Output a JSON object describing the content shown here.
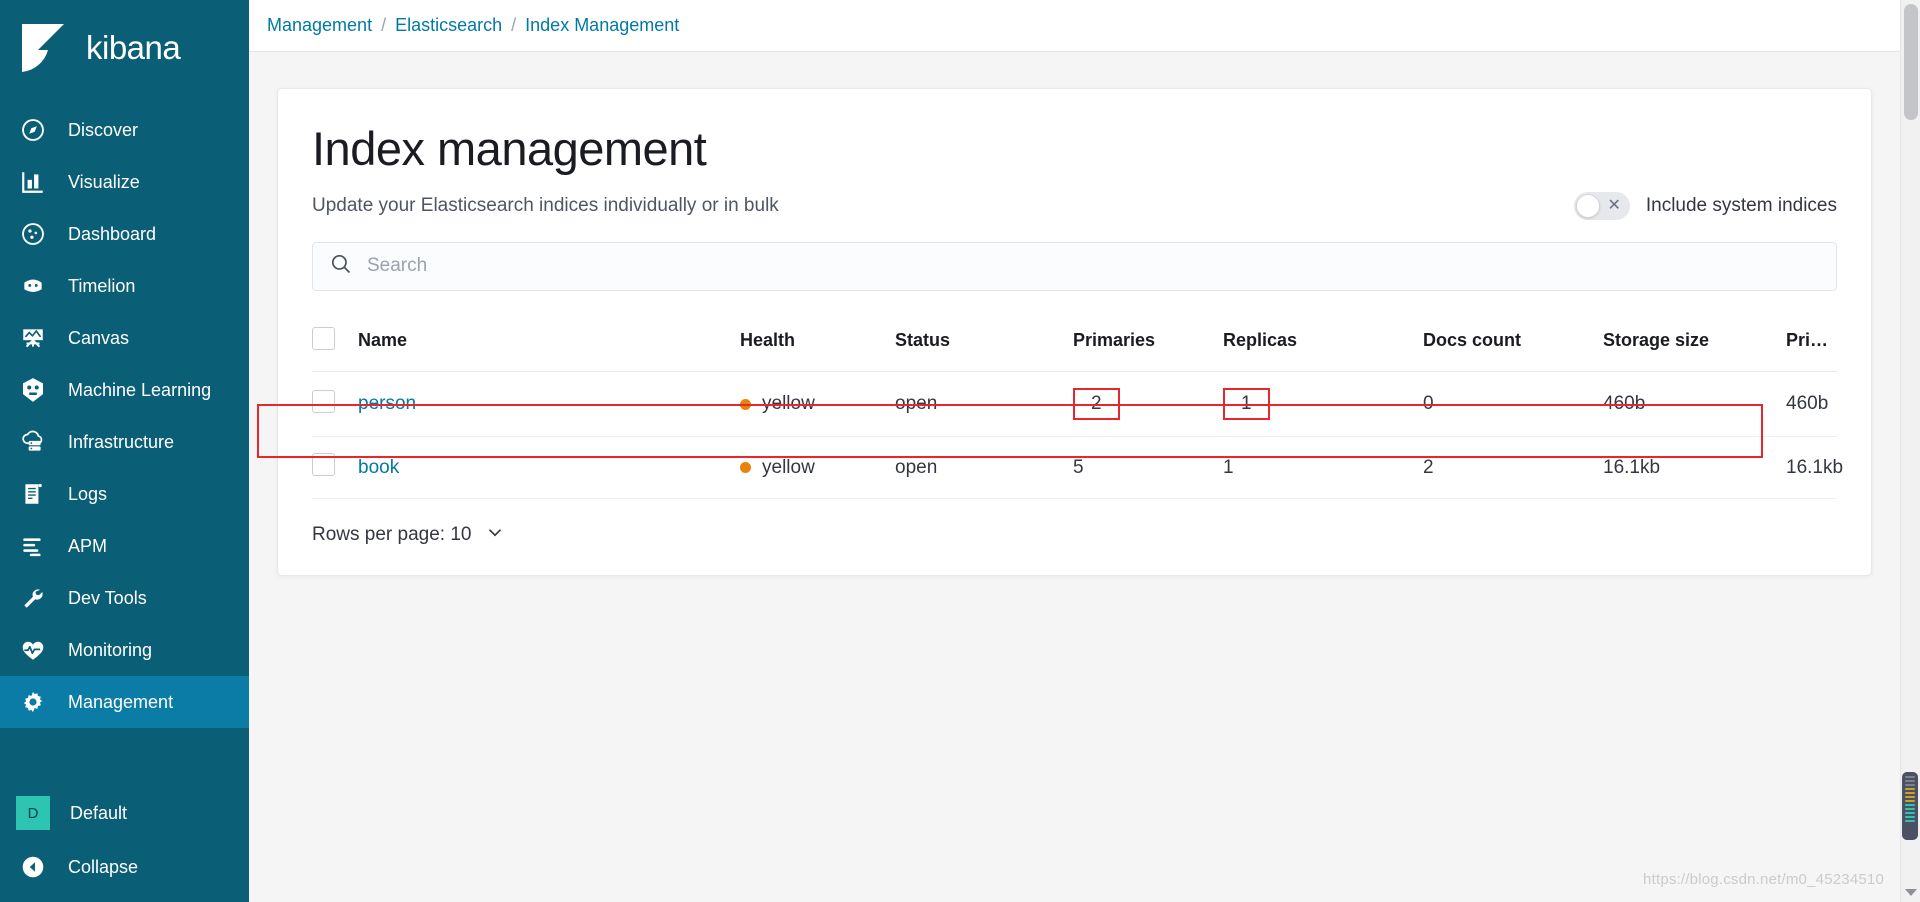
{
  "app": {
    "brand_name": "kibana",
    "accent_teal": "#0a5e75",
    "accent_active": "#0a7ca5",
    "link_blue": "#0079a5",
    "health_yellow": "#e8820a",
    "highlight_red": "#e8272c",
    "avatar_green": "#2ec4b2"
  },
  "sidebar": {
    "items": [
      {
        "label": "Discover",
        "icon": "compass-icon",
        "active": false
      },
      {
        "label": "Visualize",
        "icon": "bar-chart-icon",
        "active": false
      },
      {
        "label": "Dashboard",
        "icon": "dashboard-icon",
        "active": false
      },
      {
        "label": "Timelion",
        "icon": "timelion-icon",
        "active": false
      },
      {
        "label": "Canvas",
        "icon": "canvas-icon",
        "active": false
      },
      {
        "label": "Machine Learning",
        "icon": "machine-learning-icon",
        "active": false
      },
      {
        "label": "Infrastructure",
        "icon": "infrastructure-icon",
        "active": false
      },
      {
        "label": "Logs",
        "icon": "logs-icon",
        "active": false
      },
      {
        "label": "APM",
        "icon": "apm-icon",
        "active": false
      },
      {
        "label": "Dev Tools",
        "icon": "wrench-icon",
        "active": false
      },
      {
        "label": "Monitoring",
        "icon": "heartbeat-icon",
        "active": false
      },
      {
        "label": "Management",
        "icon": "gear-icon",
        "active": true
      }
    ],
    "space": {
      "label": "Default",
      "initial": "D"
    },
    "collapse": {
      "label": "Collapse",
      "icon": "arrow-left-circle-icon"
    }
  },
  "breadcrumb": {
    "separator": "/",
    "items": [
      "Management",
      "Elasticsearch",
      "Index Management"
    ]
  },
  "page": {
    "title": "Index management",
    "subtitle": "Update your Elasticsearch indices individually or in bulk",
    "system_indices_toggle": {
      "label": "Include system indices",
      "state": "off",
      "icon": "close-x-icon"
    },
    "search": {
      "placeholder": "Search",
      "value": "",
      "icon": "search-icon"
    }
  },
  "table": {
    "columns": [
      "Name",
      "Health",
      "Status",
      "Primaries",
      "Replicas",
      "Docs count",
      "Storage size",
      "Primary storag..."
    ],
    "rows": [
      {
        "name": "person",
        "health": "yellow",
        "status": "open",
        "primaries": "2",
        "replicas": "1",
        "docs_count": "0",
        "storage_size": "460b",
        "primary_storage_size": "460b",
        "row_highlighted": true,
        "primaries_highlighted": true,
        "replicas_highlighted": true
      },
      {
        "name": "book",
        "health": "yellow",
        "status": "open",
        "primaries": "5",
        "replicas": "1",
        "docs_count": "2",
        "storage_size": "16.1kb",
        "primary_storage_size": "16.1kb",
        "row_highlighted": false,
        "primaries_highlighted": false,
        "replicas_highlighted": false
      }
    ]
  },
  "footer": {
    "rows_per_page_label": "Rows per page: 10",
    "chevron_icon": "chevron-down-icon"
  },
  "watermark": {
    "text": "https://blog.csdn.net/m0_45234510"
  }
}
